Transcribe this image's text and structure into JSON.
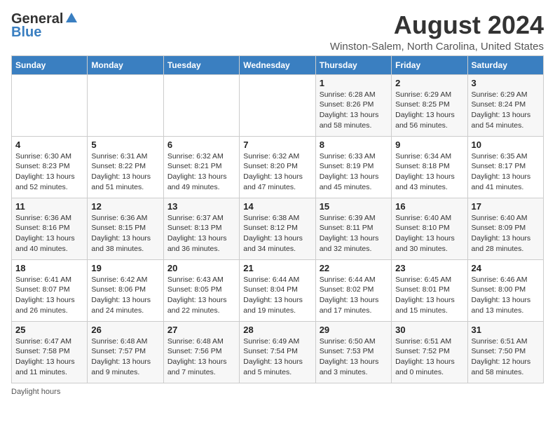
{
  "logo": {
    "general": "General",
    "blue": "Blue"
  },
  "title": "August 2024",
  "location": "Winston-Salem, North Carolina, United States",
  "days_of_week": [
    "Sunday",
    "Monday",
    "Tuesday",
    "Wednesday",
    "Thursday",
    "Friday",
    "Saturday"
  ],
  "weeks": [
    [
      {
        "day": "",
        "info": ""
      },
      {
        "day": "",
        "info": ""
      },
      {
        "day": "",
        "info": ""
      },
      {
        "day": "",
        "info": ""
      },
      {
        "day": "1",
        "info": "Sunrise: 6:28 AM\nSunset: 8:26 PM\nDaylight: 13 hours\nand 58 minutes."
      },
      {
        "day": "2",
        "info": "Sunrise: 6:29 AM\nSunset: 8:25 PM\nDaylight: 13 hours\nand 56 minutes."
      },
      {
        "day": "3",
        "info": "Sunrise: 6:29 AM\nSunset: 8:24 PM\nDaylight: 13 hours\nand 54 minutes."
      }
    ],
    [
      {
        "day": "4",
        "info": "Sunrise: 6:30 AM\nSunset: 8:23 PM\nDaylight: 13 hours\nand 52 minutes."
      },
      {
        "day": "5",
        "info": "Sunrise: 6:31 AM\nSunset: 8:22 PM\nDaylight: 13 hours\nand 51 minutes."
      },
      {
        "day": "6",
        "info": "Sunrise: 6:32 AM\nSunset: 8:21 PM\nDaylight: 13 hours\nand 49 minutes."
      },
      {
        "day": "7",
        "info": "Sunrise: 6:32 AM\nSunset: 8:20 PM\nDaylight: 13 hours\nand 47 minutes."
      },
      {
        "day": "8",
        "info": "Sunrise: 6:33 AM\nSunset: 8:19 PM\nDaylight: 13 hours\nand 45 minutes."
      },
      {
        "day": "9",
        "info": "Sunrise: 6:34 AM\nSunset: 8:18 PM\nDaylight: 13 hours\nand 43 minutes."
      },
      {
        "day": "10",
        "info": "Sunrise: 6:35 AM\nSunset: 8:17 PM\nDaylight: 13 hours\nand 41 minutes."
      }
    ],
    [
      {
        "day": "11",
        "info": "Sunrise: 6:36 AM\nSunset: 8:16 PM\nDaylight: 13 hours\nand 40 minutes."
      },
      {
        "day": "12",
        "info": "Sunrise: 6:36 AM\nSunset: 8:15 PM\nDaylight: 13 hours\nand 38 minutes."
      },
      {
        "day": "13",
        "info": "Sunrise: 6:37 AM\nSunset: 8:13 PM\nDaylight: 13 hours\nand 36 minutes."
      },
      {
        "day": "14",
        "info": "Sunrise: 6:38 AM\nSunset: 8:12 PM\nDaylight: 13 hours\nand 34 minutes."
      },
      {
        "day": "15",
        "info": "Sunrise: 6:39 AM\nSunset: 8:11 PM\nDaylight: 13 hours\nand 32 minutes."
      },
      {
        "day": "16",
        "info": "Sunrise: 6:40 AM\nSunset: 8:10 PM\nDaylight: 13 hours\nand 30 minutes."
      },
      {
        "day": "17",
        "info": "Sunrise: 6:40 AM\nSunset: 8:09 PM\nDaylight: 13 hours\nand 28 minutes."
      }
    ],
    [
      {
        "day": "18",
        "info": "Sunrise: 6:41 AM\nSunset: 8:07 PM\nDaylight: 13 hours\nand 26 minutes."
      },
      {
        "day": "19",
        "info": "Sunrise: 6:42 AM\nSunset: 8:06 PM\nDaylight: 13 hours\nand 24 minutes."
      },
      {
        "day": "20",
        "info": "Sunrise: 6:43 AM\nSunset: 8:05 PM\nDaylight: 13 hours\nand 22 minutes."
      },
      {
        "day": "21",
        "info": "Sunrise: 6:44 AM\nSunset: 8:04 PM\nDaylight: 13 hours\nand 19 minutes."
      },
      {
        "day": "22",
        "info": "Sunrise: 6:44 AM\nSunset: 8:02 PM\nDaylight: 13 hours\nand 17 minutes."
      },
      {
        "day": "23",
        "info": "Sunrise: 6:45 AM\nSunset: 8:01 PM\nDaylight: 13 hours\nand 15 minutes."
      },
      {
        "day": "24",
        "info": "Sunrise: 6:46 AM\nSunset: 8:00 PM\nDaylight: 13 hours\nand 13 minutes."
      }
    ],
    [
      {
        "day": "25",
        "info": "Sunrise: 6:47 AM\nSunset: 7:58 PM\nDaylight: 13 hours\nand 11 minutes."
      },
      {
        "day": "26",
        "info": "Sunrise: 6:48 AM\nSunset: 7:57 PM\nDaylight: 13 hours\nand 9 minutes."
      },
      {
        "day": "27",
        "info": "Sunrise: 6:48 AM\nSunset: 7:56 PM\nDaylight: 13 hours\nand 7 minutes."
      },
      {
        "day": "28",
        "info": "Sunrise: 6:49 AM\nSunset: 7:54 PM\nDaylight: 13 hours\nand 5 minutes."
      },
      {
        "day": "29",
        "info": "Sunrise: 6:50 AM\nSunset: 7:53 PM\nDaylight: 13 hours\nand 3 minutes."
      },
      {
        "day": "30",
        "info": "Sunrise: 6:51 AM\nSunset: 7:52 PM\nDaylight: 13 hours\nand 0 minutes."
      },
      {
        "day": "31",
        "info": "Sunrise: 6:51 AM\nSunset: 7:50 PM\nDaylight: 12 hours\nand 58 minutes."
      }
    ]
  ],
  "footer": "Daylight hours"
}
